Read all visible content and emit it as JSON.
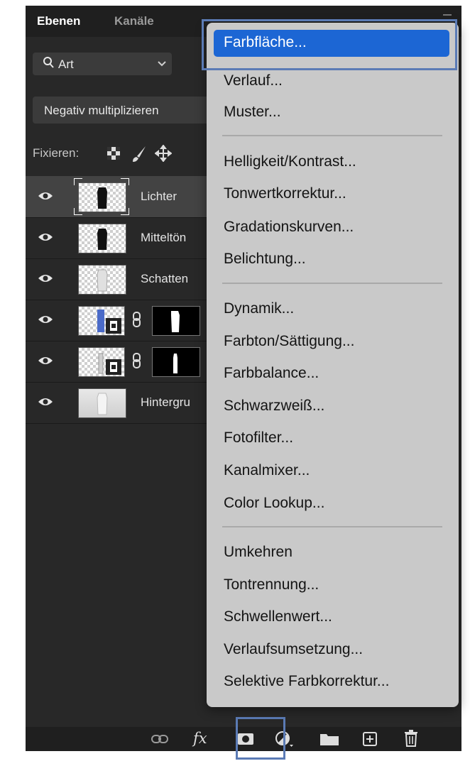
{
  "tabs": [
    {
      "label": "Ebenen",
      "active": true
    },
    {
      "label": "Kanäle",
      "active": false
    }
  ],
  "filter": {
    "icon": "search-icon",
    "label": "Art"
  },
  "blend_mode": {
    "value": "Negativ multiplizieren"
  },
  "lock": {
    "label": "Fixieren:"
  },
  "layers": [
    {
      "name": "Lichter",
      "selected": true
    },
    {
      "name": "Mitteltön"
    },
    {
      "name": "Schatten"
    },
    {
      "name": ""
    },
    {
      "name": ""
    },
    {
      "name": "Hintergru"
    }
  ],
  "menu": {
    "items": [
      "Farbfläche...",
      "Verlauf...",
      "Muster...",
      "Helligkeit/Kontrast...",
      "Tonwertkorrektur...",
      "Gradationskurven...",
      "Belichtung...",
      "Dynamik...",
      "Farbton/Sättigung...",
      "Farbbalance...",
      "Schwarzweiß...",
      "Fotofilter...",
      "Kanalmixer...",
      "Color Lookup...",
      "Umkehren",
      "Tontrennung...",
      "Schwellenwert...",
      "Verlaufsumsetzung...",
      "Selektive Farbkorrektur..."
    ],
    "highlighted": "Farbfläche..."
  },
  "bottom_bar": {
    "fx_label": "fx"
  },
  "colors": {
    "panel": "#282828",
    "menu": "#c9c9c9",
    "highlight": "#1c66d4",
    "annotation": "#5b7bb5"
  }
}
